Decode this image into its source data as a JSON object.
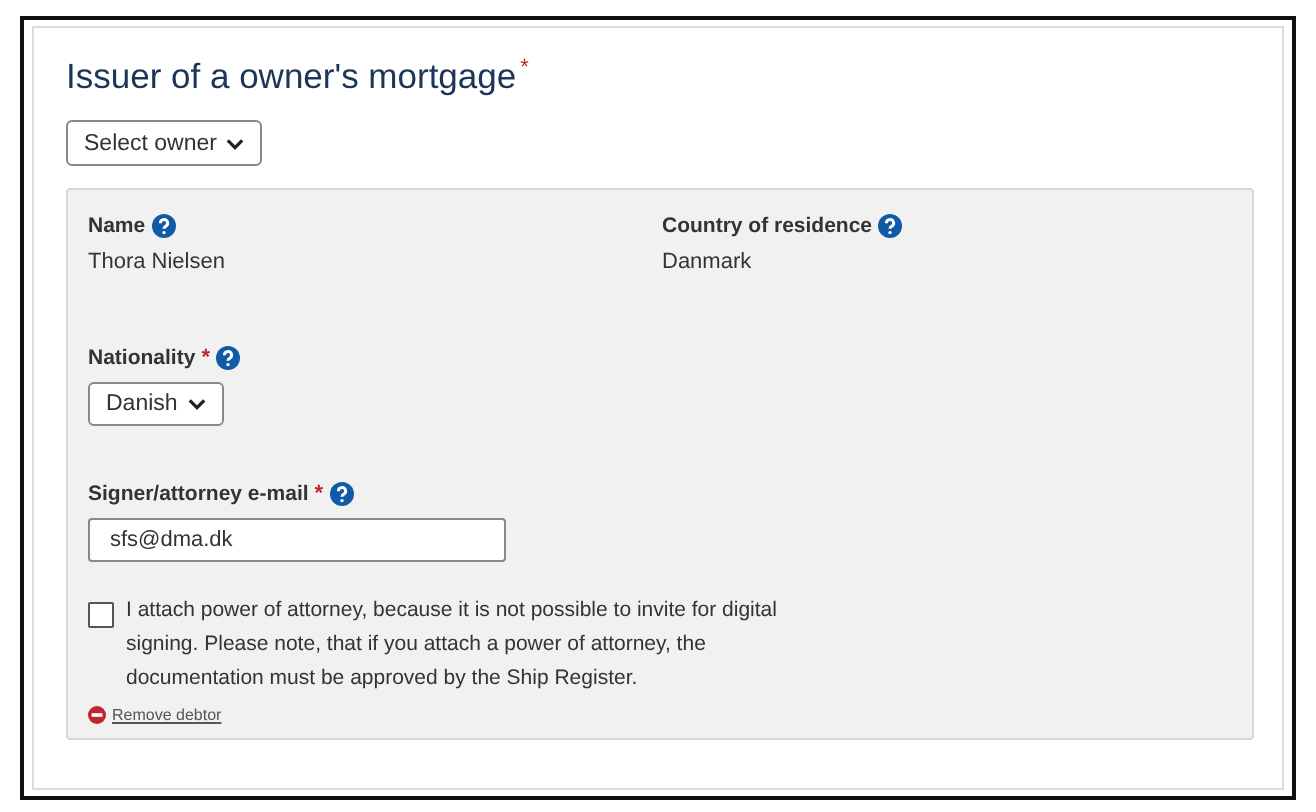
{
  "title": "Issuer of a owner's mortgage",
  "title_mark": "*",
  "owner_select": {
    "label": "Select owner"
  },
  "fields": [
    {
      "label": "Name",
      "value": "Thora Nielsen"
    },
    {
      "label": "Country of residence",
      "value": "Danmark"
    }
  ],
  "nationality": {
    "label": "Nationality",
    "required_mark": "*",
    "value": "Danish"
  },
  "email": {
    "label": "Signer/attorney e-mail",
    "required_mark": "*",
    "value": "sfs@dma.dk"
  },
  "power_of_attorney": {
    "checked": false,
    "text": "I attach power of attorney, because it is not possible to invite for digital signing. Please note, that if you attach a power of attorney, the documentation must be approved by the Ship Register."
  },
  "remove_link": "Remove debtor"
}
